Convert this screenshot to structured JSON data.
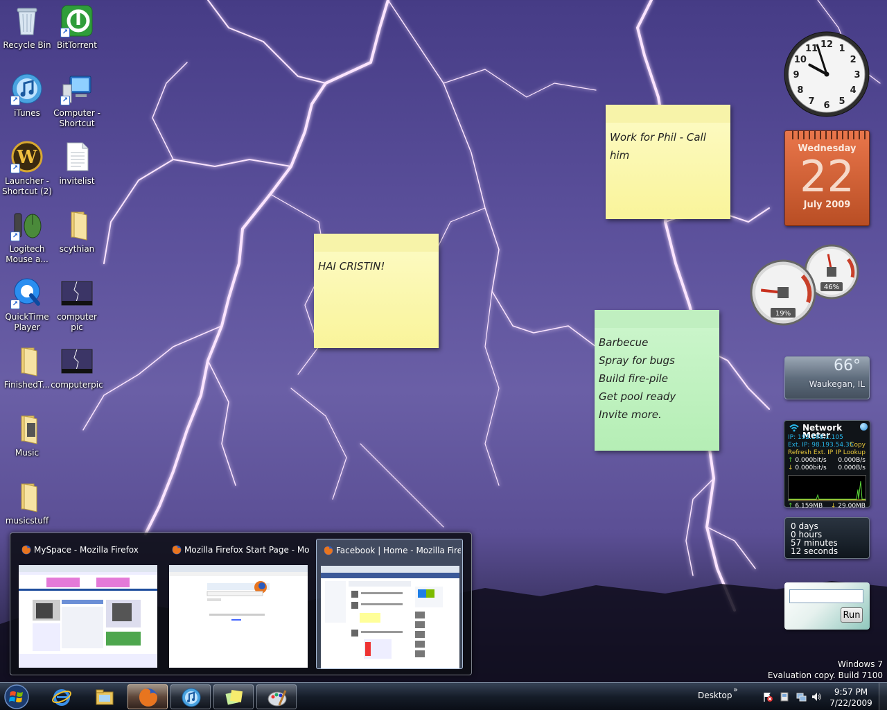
{
  "desktop": {
    "icons": [
      {
        "label": "Recycle Bin",
        "icon": "recycle-bin-icon"
      },
      {
        "label": "BitTorrent",
        "icon": "bittorrent-icon"
      },
      {
        "label": "iTunes",
        "icon": "itunes-icon"
      },
      {
        "label": "Computer -\nShortcut",
        "icon": "computer-icon"
      },
      {
        "label": "Launcher -\nShortcut (2)",
        "icon": "wow-launcher-icon"
      },
      {
        "label": "invitelist",
        "icon": "text-file-icon"
      },
      {
        "label": "Logitech\nMouse a...",
        "icon": "logitech-mouse-icon"
      },
      {
        "label": "scythian",
        "icon": "folder-icon"
      },
      {
        "label": "QuickTime\nPlayer",
        "icon": "quicktime-icon"
      },
      {
        "label": "computer pic",
        "icon": "image-thumbnail-icon"
      },
      {
        "label": "FinishedT...",
        "icon": "folder-icon"
      },
      {
        "label": "computerpic",
        "icon": "image-thumbnail-icon"
      },
      {
        "label": "Music",
        "icon": "music-folder-icon"
      },
      {
        "label": "musicstuff",
        "icon": "folder-icon"
      }
    ]
  },
  "sticky_notes": [
    {
      "text": "HAI CRISTIN!",
      "color": "yellow"
    },
    {
      "text": "Work for Phil - Call\nhim",
      "color": "yellow"
    },
    {
      "text": "Barbecue\nSpray for bugs\nBuild fire-pile\nGet pool ready\nInvite more.",
      "color": "green"
    }
  ],
  "gadgets": {
    "clock": {
      "numerals": [
        "12",
        "1",
        "2",
        "3",
        "4",
        "5",
        "6",
        "7",
        "8",
        "9",
        "10",
        "11"
      ],
      "hour": 9,
      "minute": 57,
      "second": 0
    },
    "calendar": {
      "weekday": "Wednesday",
      "day": "22",
      "month_year": "July 2009"
    },
    "cpu_meter": {
      "cpu": "19%",
      "memory": "46%",
      "cpu_value": 19,
      "memory_value": 46
    },
    "weather": {
      "temp": "66°",
      "city": "Waukegan, IL"
    },
    "network_meter": {
      "title": "Network Meter",
      "ip": "IP: 192.168.1.105",
      "ext_ip": "Ext. IP: 98.193.54.35",
      "copy": "Copy",
      "refresh": "Refresh Ext. IP",
      "lookup": "IP Lookup",
      "up_bits": "0.000bit/s",
      "up_bytes": "0.000B/s",
      "down_bits": "0.000bit/s",
      "down_bytes": "0.000B/s",
      "total_up": "6.159MB",
      "total_down": "29.00MB"
    },
    "uptime": {
      "days": "0 days",
      "hours": "0 hours",
      "minutes": "57 minutes",
      "seconds": "12 seconds"
    },
    "run": {
      "button": "Run",
      "value": ""
    }
  },
  "thumbnails": [
    {
      "title": "MySpace - Mozilla Firefox",
      "active": false
    },
    {
      "title": "Mozilla Firefox Start Page - Mozi...",
      "active": false
    },
    {
      "title": "Facebook | Home - Mozilla Firef...",
      "active": true
    }
  ],
  "watermark": {
    "line1": "Windows 7",
    "line2": "Evaluation copy. Build 7100"
  },
  "taskbar": {
    "buttons": [
      {
        "name": "internet-explorer",
        "icon": "internet-explorer-icon",
        "state": "pinned"
      },
      {
        "name": "windows-explorer",
        "icon": "folder-explorer-icon",
        "state": "pinned"
      },
      {
        "name": "firefox",
        "icon": "firefox-icon",
        "state": "active"
      },
      {
        "name": "itunes",
        "icon": "itunes-icon",
        "state": "running"
      },
      {
        "name": "sticky-notes",
        "icon": "sticky-notes-icon",
        "state": "running"
      },
      {
        "name": "paint",
        "icon": "paint-icon",
        "state": "running"
      }
    ],
    "desktop_toolbar": "Desktop",
    "chevron": "»",
    "time": "9:57 PM",
    "date": "7/22/2009"
  },
  "colors": {
    "sticky_yellow": "#f9f49a",
    "sticky_green": "#b5eeb5",
    "calendar": "#c85a2e",
    "lightning": "#ffe6ff"
  }
}
